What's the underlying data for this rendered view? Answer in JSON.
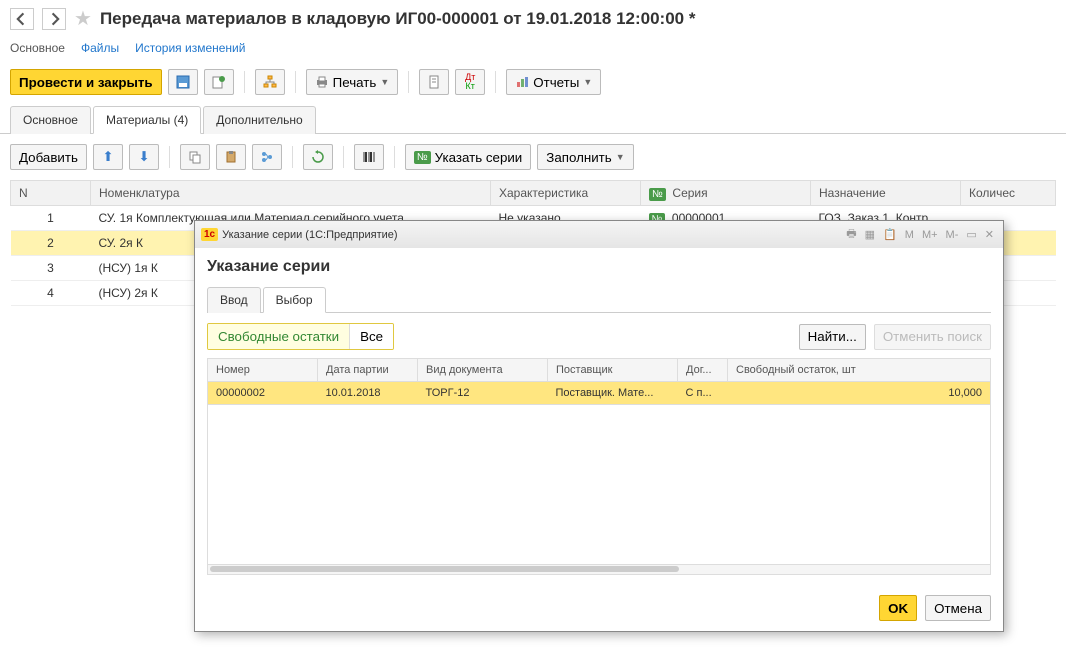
{
  "header": {
    "title": "Передача материалов в кладовую ИГ00-000001 от 19.01.2018 12:00:00 *"
  },
  "nav_links": {
    "main": "Основное",
    "files": "Файлы",
    "history": "История изменений"
  },
  "toolbar": {
    "post_and_close": "Провести и закрыть",
    "print": "Печать",
    "reports": "Отчеты"
  },
  "tabs": {
    "main": "Основное",
    "materials": "Материалы (4)",
    "additional": "Дополнительно"
  },
  "sub_toolbar": {
    "add": "Добавить",
    "specify_series": "Указать серии",
    "fill": "Заполнить"
  },
  "grid": {
    "headers": {
      "n": "N",
      "nomenclature": "Номенклатура",
      "characteristic": "Характеристика",
      "series_badge": "№",
      "series": "Серия",
      "purpose": "Назначение",
      "qty": "Количес"
    },
    "rows": [
      {
        "n": "1",
        "nom": "СУ. 1я Комплектующая или Материал серийного учета",
        "char": "Не указано",
        "ser": "00000001",
        "naz": "ГОЗ. Заказ 1. Контр"
      },
      {
        "n": "2",
        "nom": "СУ. 2я К",
        "char": "",
        "ser": "",
        "naz": ""
      },
      {
        "n": "3",
        "nom": "(НСУ) 1я К",
        "char": "",
        "ser": "",
        "naz": ""
      },
      {
        "n": "4",
        "nom": "(НСУ) 2я К",
        "char": "",
        "ser": "",
        "naz": ""
      }
    ]
  },
  "dialog": {
    "titlebar": "Указание серии  (1С:Предприятие)",
    "heading": "Указание серии",
    "tabs": {
      "input": "Ввод",
      "select": "Выбор"
    },
    "filters": {
      "free": "Свободные остатки",
      "all": "Все"
    },
    "buttons": {
      "find": "Найти...",
      "cancel_search": "Отменить поиск",
      "ok": "OK",
      "cancel": "Отмена"
    },
    "grid": {
      "headers": {
        "number": "Номер",
        "batch_date": "Дата партии",
        "doc_type": "Вид документа",
        "supplier": "Поставщик",
        "contract": "Дог...",
        "free_balance": "Свободный остаток, шт"
      },
      "rows": [
        {
          "number": "00000002",
          "batch_date": "10.01.2018",
          "doc_type": "ТОРГ-12",
          "supplier": "Поставщик. Мате...",
          "contract": "С п...",
          "balance": "10,000"
        }
      ]
    },
    "win_icons": {
      "m": "M",
      "mplus": "M+",
      "mminus": "M-"
    }
  }
}
